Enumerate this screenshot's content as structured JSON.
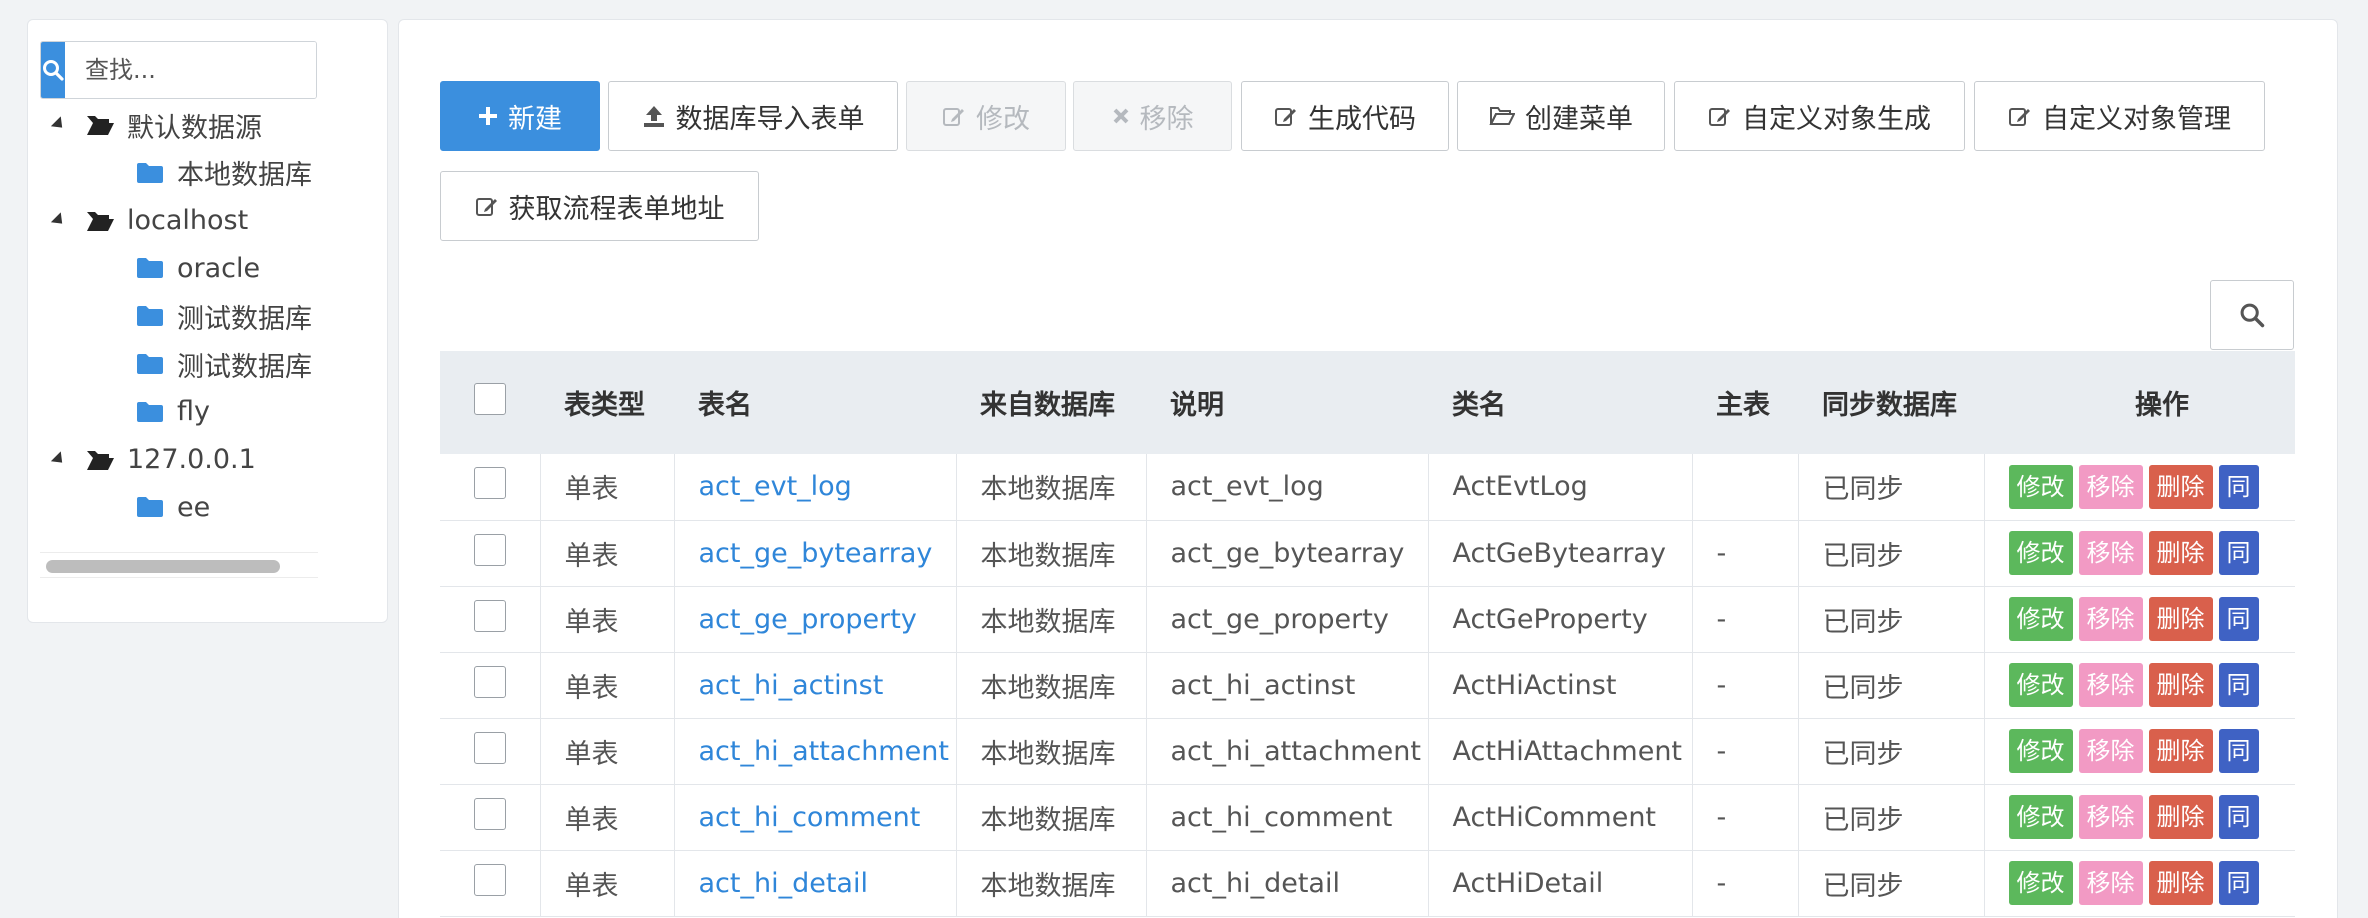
{
  "sidebar": {
    "search": {
      "placeholder": "查找..."
    },
    "tree": [
      {
        "label": "默认数据源",
        "level": 0,
        "type": "folder-open"
      },
      {
        "label": "本地数据库",
        "level": 1,
        "type": "folder"
      },
      {
        "label": "localhost",
        "level": 0,
        "type": "folder-open"
      },
      {
        "label": "oracle",
        "level": 1,
        "type": "folder"
      },
      {
        "label": "测试数据库",
        "level": 1,
        "type": "folder"
      },
      {
        "label": "测试数据库",
        "level": 1,
        "type": "folder"
      },
      {
        "label": "fly",
        "level": 1,
        "type": "folder"
      },
      {
        "label": "127.0.0.1",
        "level": 0,
        "type": "folder-open"
      },
      {
        "label": "ee",
        "level": 1,
        "type": "folder"
      }
    ]
  },
  "toolbar": {
    "new": "新建",
    "import": "数据库导入表单",
    "edit": "修改",
    "remove": "移除",
    "gen_code": "生成代码",
    "create_menu": "创建菜单",
    "custom_gen": "自定义对象生成",
    "custom_manage": "自定义对象管理",
    "get_flow_url": "获取流程表单地址"
  },
  "colors": {
    "primary": "#3b8fde",
    "edit": "#5cb85c",
    "move": "#f29ac4",
    "delete": "#d9604c",
    "sync": "#3f62c4",
    "link": "#2f86d9"
  },
  "table": {
    "headers": {
      "type": "表类型",
      "name": "表名",
      "source": "来自数据库",
      "desc": "说明",
      "class": "类名",
      "master": "主表",
      "sync": "同步数据库",
      "ops": "操作"
    },
    "op_labels": {
      "edit": "修改",
      "move": "移除",
      "delete": "删除",
      "sync": "同"
    },
    "rows": [
      {
        "type": "单表",
        "name": "act_evt_log",
        "source": "本地数据库",
        "desc": "act_evt_log",
        "class": "ActEvtLog",
        "master": "",
        "sync": "已同步"
      },
      {
        "type": "单表",
        "name": "act_ge_bytearray",
        "source": "本地数据库",
        "desc": "act_ge_bytearray",
        "class": "ActGeBytearray",
        "master": "-",
        "sync": "已同步"
      },
      {
        "type": "单表",
        "name": "act_ge_property",
        "source": "本地数据库",
        "desc": "act_ge_property",
        "class": "ActGeProperty",
        "master": "-",
        "sync": "已同步"
      },
      {
        "type": "单表",
        "name": "act_hi_actinst",
        "source": "本地数据库",
        "desc": "act_hi_actinst",
        "class": "ActHiActinst",
        "master": "-",
        "sync": "已同步"
      },
      {
        "type": "单表",
        "name": "act_hi_attachment",
        "source": "本地数据库",
        "desc": "act_hi_attachment",
        "class": "ActHiAttachment",
        "master": "-",
        "sync": "已同步"
      },
      {
        "type": "单表",
        "name": "act_hi_comment",
        "source": "本地数据库",
        "desc": "act_hi_comment",
        "class": "ActHiComment",
        "master": "-",
        "sync": "已同步"
      },
      {
        "type": "单表",
        "name": "act_hi_detail",
        "source": "本地数据库",
        "desc": "act_hi_detail",
        "class": "ActHiDetail",
        "master": "-",
        "sync": "已同步"
      }
    ]
  }
}
